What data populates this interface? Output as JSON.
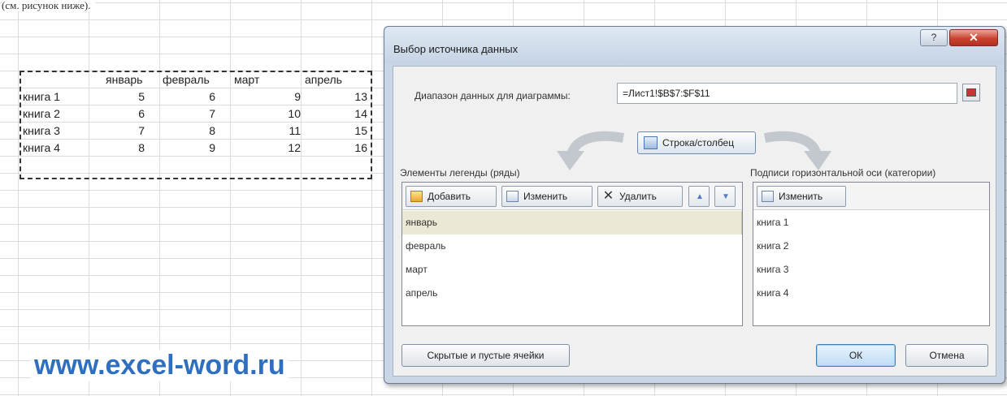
{
  "caption": "(см. рисунок ниже).",
  "watermark": "www.excel-word.ru",
  "sheet": {
    "headers": [
      "январь",
      "февраль",
      "март",
      "апрель"
    ],
    "rows": [
      {
        "label": "книга 1",
        "values": [
          "5",
          "6",
          "9",
          "13"
        ]
      },
      {
        "label": "книга 2",
        "values": [
          "6",
          "7",
          "10",
          "14"
        ]
      },
      {
        "label": "книга 3",
        "values": [
          "7",
          "8",
          "11",
          "15"
        ]
      },
      {
        "label": "книга 4",
        "values": [
          "8",
          "9",
          "12",
          "16"
        ]
      }
    ]
  },
  "dialog": {
    "title": "Выбор источника данных",
    "help_label": "?",
    "close_label": "✕",
    "range_label": "Диапазон данных для диаграммы:",
    "range_value": "=Лист1!$B$7:$F$11",
    "switch_label": "Строка/столбец",
    "legend_label": "Элементы легенды (ряды)",
    "axis_label": "Подписи горизонтальной оси (категории)",
    "legend_toolbar": {
      "add": "Добавить",
      "edit": "Изменить",
      "delete": "Удалить"
    },
    "axis_toolbar": {
      "edit": "Изменить"
    },
    "legend_items": [
      "январь",
      "февраль",
      "март",
      "апрель"
    ],
    "axis_items": [
      "книга 1",
      "книга 2",
      "книга 3",
      "книга 4"
    ],
    "hidden_cells_label": "Скрытые и пустые ячейки",
    "ok_label": "ОК",
    "cancel_label": "Отмена"
  }
}
